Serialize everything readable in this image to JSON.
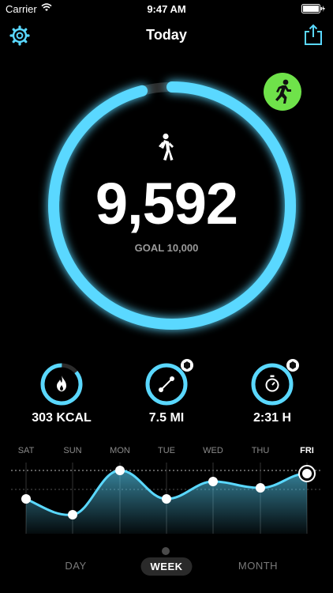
{
  "status": {
    "carrier": "Carrier",
    "time": "9:47 AM"
  },
  "nav": {
    "title": "Today"
  },
  "main": {
    "steps": "9,592",
    "goal_label": "GOAL",
    "goal_value": "10,000",
    "progress": 0.959
  },
  "metrics": [
    {
      "value": "303 KCAL",
      "icon": "flame-icon"
    },
    {
      "value": "7.5 MI",
      "icon": "route-icon"
    },
    {
      "value": "2:31 H",
      "icon": "stopwatch-icon"
    }
  ],
  "week": {
    "days": [
      "SAT",
      "SUN",
      "MON",
      "TUE",
      "WED",
      "THU",
      "FRI"
    ],
    "today": "FRI"
  },
  "tabs": [
    "DAY",
    "WEEK",
    "MONTH"
  ],
  "active_tab": "WEEK",
  "colors": {
    "accent": "#5ad8ff",
    "run_button": "#6fe24a"
  }
}
